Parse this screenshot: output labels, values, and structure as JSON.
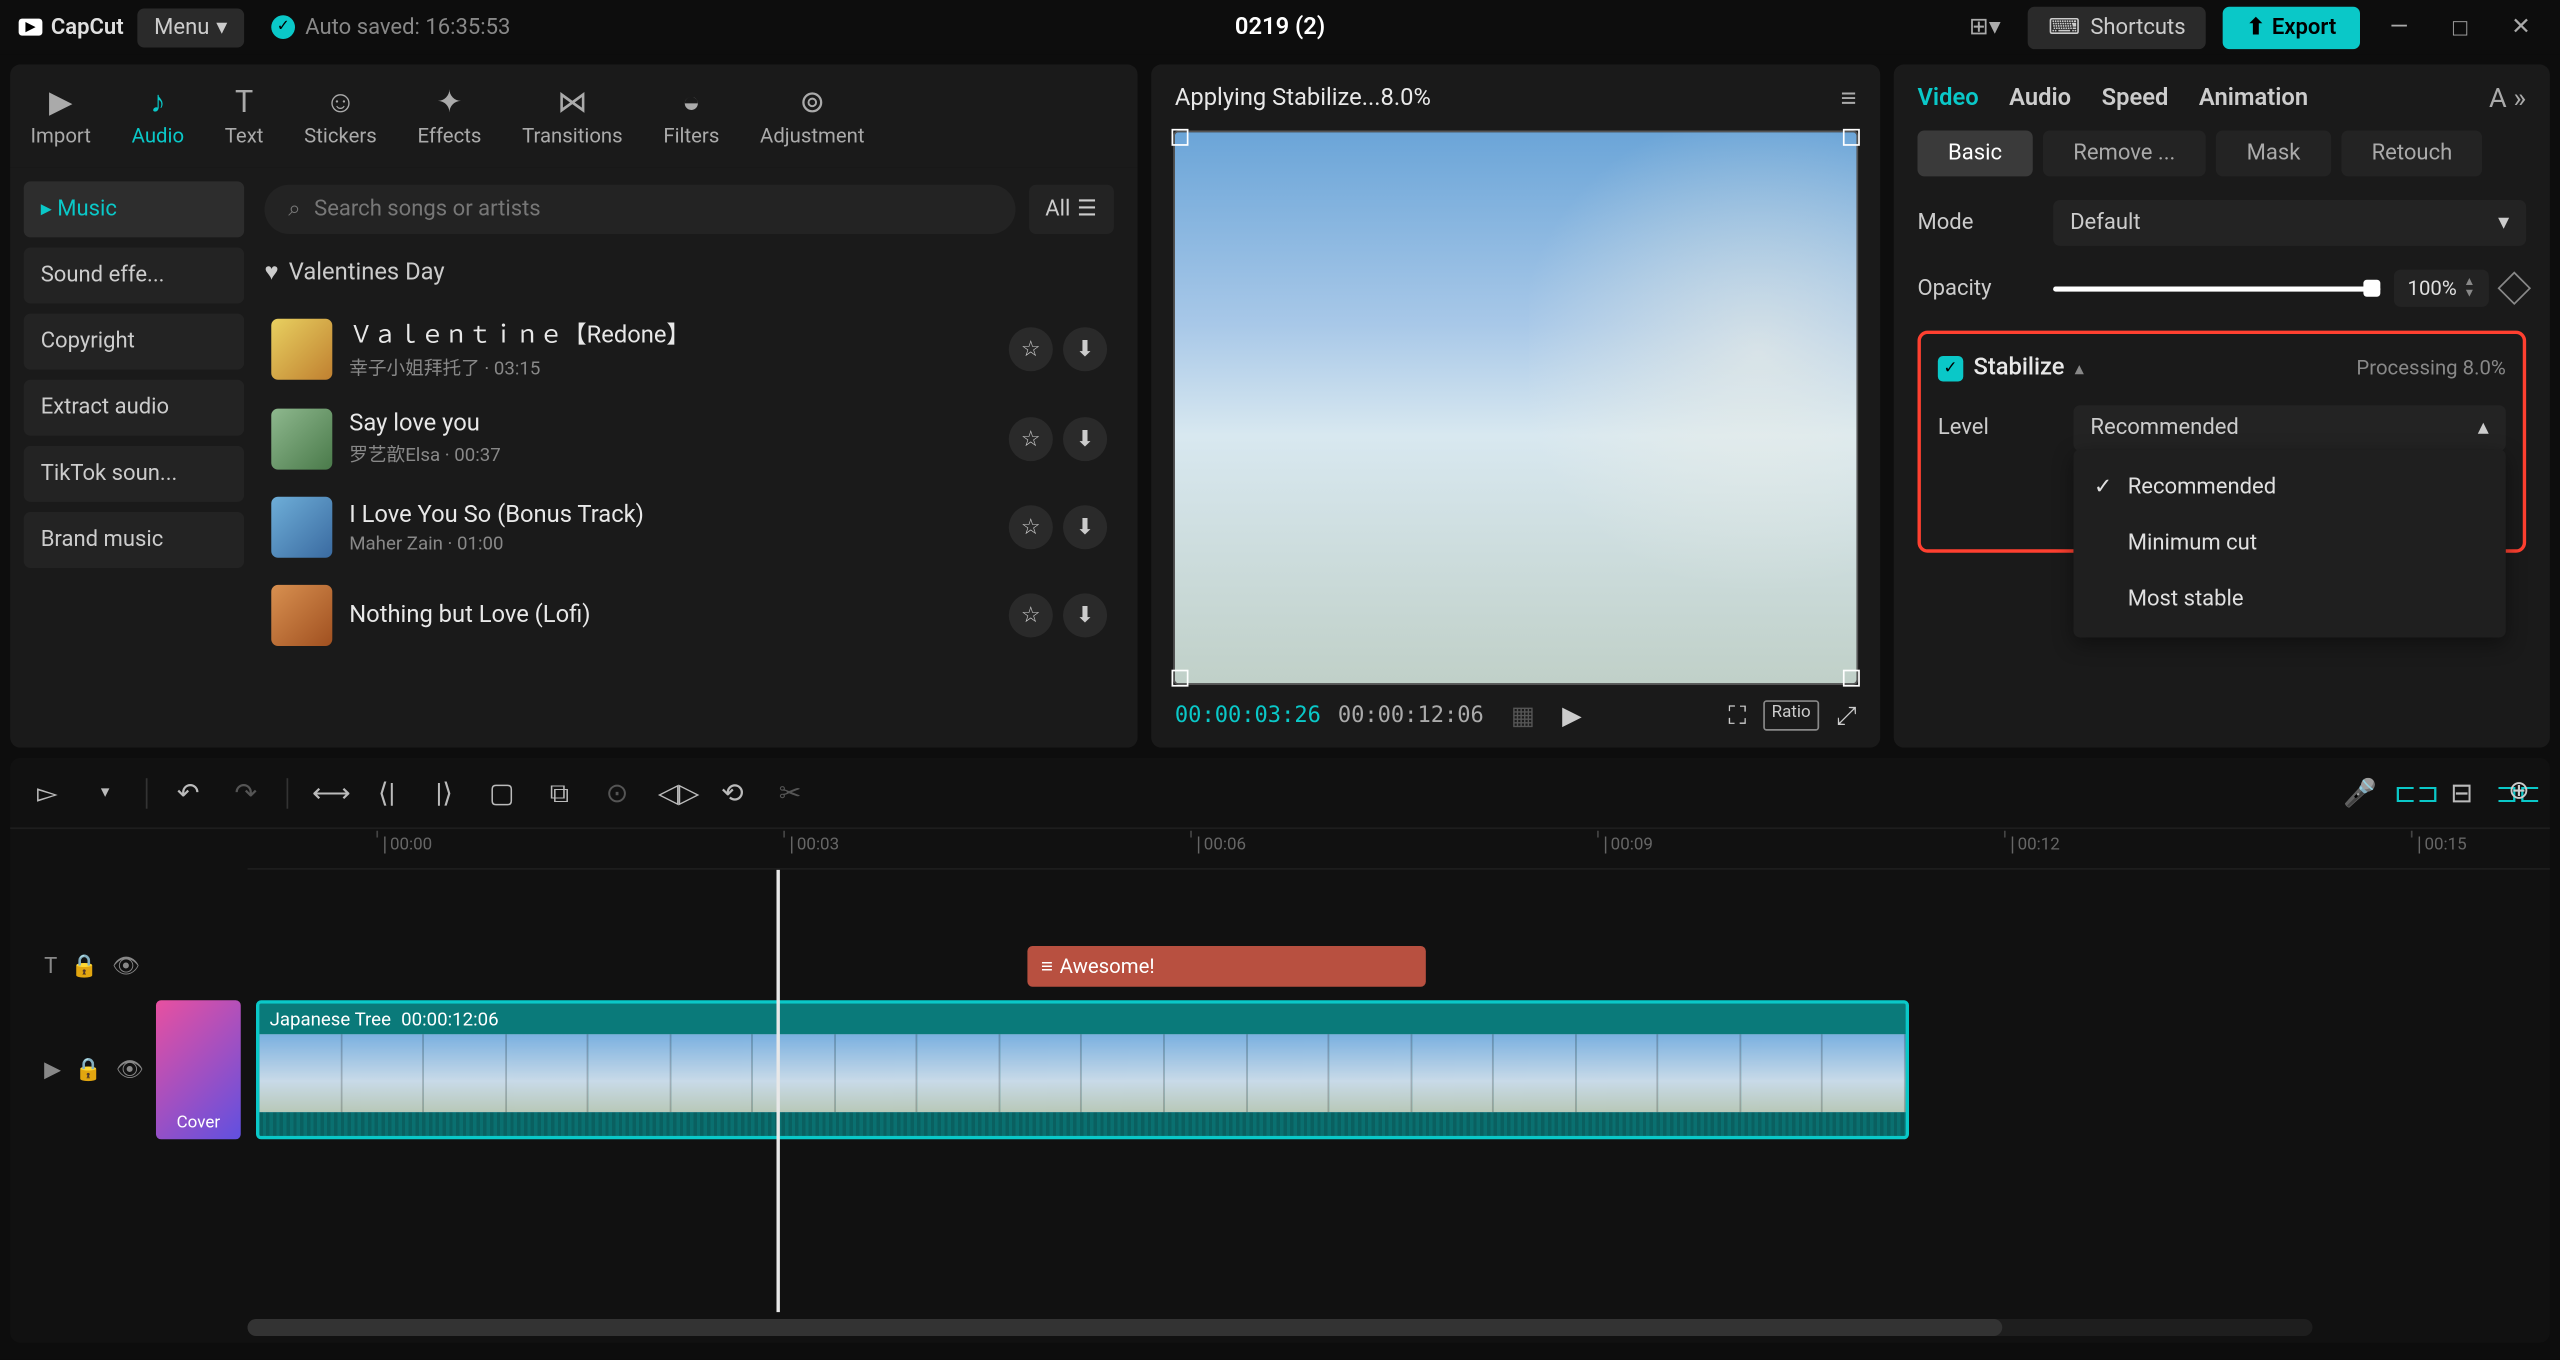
{
  "titlebar": {
    "logo": "CapCut",
    "menu": "Menu",
    "autosave": "Auto saved: 16:35:53",
    "project": "0219 (2)",
    "shortcuts": "Shortcuts",
    "export": "Export"
  },
  "top_tabs": [
    "Import",
    "Audio",
    "Text",
    "Stickers",
    "Effects",
    "Transitions",
    "Filters",
    "Adjustment"
  ],
  "side_cats": [
    "Music",
    "Sound effe...",
    "Copyright",
    "Extract audio",
    "TikTok soun...",
    "Brand music"
  ],
  "search_placeholder": "Search songs or artists",
  "all_label": "All",
  "section": "Valentines Day",
  "songs": [
    {
      "title": "Ｖａｌｅｎｔｉｎｅ【Redone】",
      "meta": "幸子小姐拜托了 · 03:15"
    },
    {
      "title": "Say love you",
      "meta": "罗艺歆Elsa · 00:37"
    },
    {
      "title": "I Love You So (Bonus Track)",
      "meta": "Maher Zain · 01:00"
    },
    {
      "title": "Nothing but Love (Lofi)",
      "meta": ""
    }
  ],
  "preview": {
    "title": "Applying Stabilize...8.0%",
    "tc_cur": "00:00:03:26",
    "tc_tot": "00:00:12:06",
    "ratio": "Ratio"
  },
  "rp_tabs": [
    "Video",
    "Audio",
    "Speed",
    "Animation"
  ],
  "rp_more": "A",
  "rp_subtabs": [
    "Basic",
    "Remove ...",
    "Mask",
    "Retouch"
  ],
  "rp": {
    "mode_label": "Mode",
    "mode_value": "Default",
    "opacity_label": "Opacity",
    "opacity_value": "100%",
    "stab_label": "Stabilize",
    "stab_proc": "Processing 8.0%",
    "level_label": "Level",
    "level_value": "Recommended",
    "options": [
      "Recommended",
      "Minimum cut",
      "Most stable"
    ]
  },
  "ruler": [
    "00:00",
    "00:03",
    "00:06",
    "00:09",
    "00:12",
    "00:15"
  ],
  "clip_text": "Awesome!",
  "clip_vid_name": "Japanese Tree",
  "clip_vid_dur": "00:00:12:06",
  "cover": "Cover"
}
